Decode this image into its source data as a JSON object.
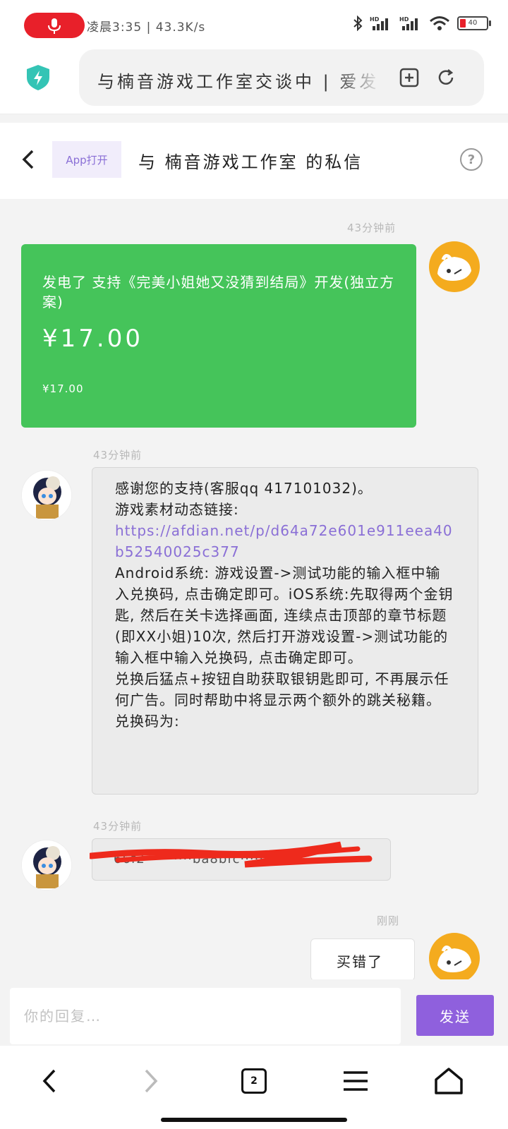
{
  "status_bar": {
    "time_speed": "凌晨3:35 | 43.3K/s",
    "battery": "40"
  },
  "browser": {
    "url_text": "与楠音游戏工作室交谈中 | 爱发电"
  },
  "header": {
    "app_open_label": "App打开",
    "title": "与 楠音游戏工作室 的私信"
  },
  "messages": {
    "m1_time": "43分钟前",
    "pay_card": {
      "desc": "发电了 支持《完美小姐她又没猜到结局》开发(独立方案)",
      "amount": "¥17.00",
      "amount_small": "¥17.00"
    },
    "m2_time": "43分钟前",
    "m2_line1": "感谢您的支持(客服qq 417101032)。",
    "m2_line2": "游戏素材动态链接:",
    "m2_link": "https://afdian.net/p/d64a72e601e911eea40b52540025c377",
    "m2_body": "Android系统: 游戏设置->测试功能的输入框中输入兑换码, 点击确定即可。iOS系统:先取得两个金钥匙, 然后在关卡选择画面, 连续点击顶部的章节标题(即XX小姐)10次, 然后打开游戏设置->测试功能的输入框中输入兑换码, 点击确定即可。\n兑换后猛点+按钮自助获取银钥匙即可, 不再展示任何广告。同时帮助中将显示两个额外的跳关秘籍。\n兑换码为:",
    "m3_time": "43分钟前",
    "m3_code": "66f2··········ba8bfc·····8ac",
    "m4_time": "刚刚",
    "m4_text": "买错了"
  },
  "composer": {
    "placeholder": "你的回复…",
    "send_label": "发送"
  },
  "nav": {
    "tab_count": "2"
  },
  "colors": {
    "accent": "#8f60dd",
    "pay_green": "#45c45a",
    "record_red": "#e8202a",
    "link": "#8a6fd6",
    "scribble": "#ee2a1c"
  }
}
